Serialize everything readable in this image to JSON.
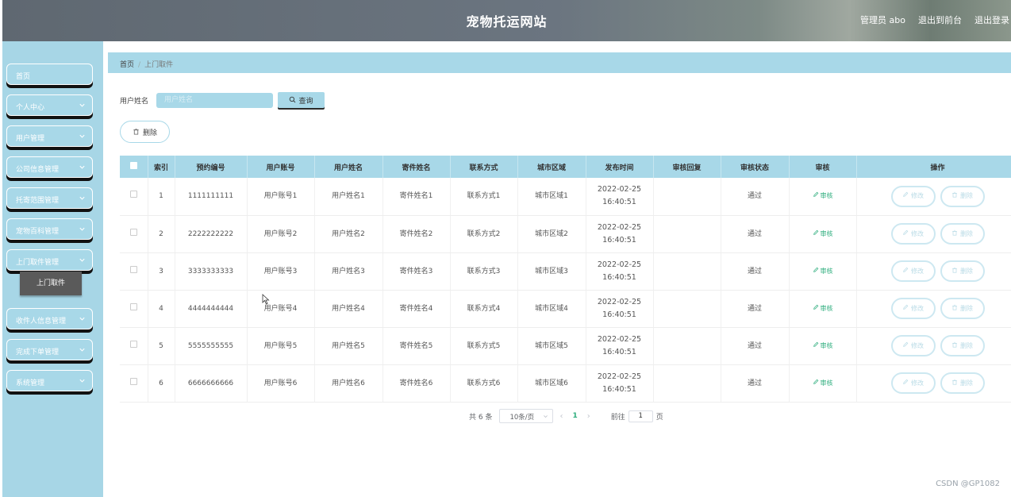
{
  "header": {
    "title": "宠物托运网站",
    "admin_label": "管理员 abo",
    "front_link": "退出到前台",
    "logout_link": "退出登录"
  },
  "sidebar": {
    "items": [
      {
        "label": "首页",
        "has_chevron": false
      },
      {
        "label": "个人中心",
        "has_chevron": true
      },
      {
        "label": "用户管理",
        "has_chevron": true
      },
      {
        "label": "公司信息管理",
        "has_chevron": true
      },
      {
        "label": "托寄范围管理",
        "has_chevron": true
      },
      {
        "label": "宠物百科管理",
        "has_chevron": true
      },
      {
        "label": "上门取件管理",
        "has_chevron": true
      },
      {
        "label": "收件人信息管理",
        "has_chevron": true
      },
      {
        "label": "完成下单管理",
        "has_chevron": true
      },
      {
        "label": "系统管理",
        "has_chevron": true
      }
    ],
    "active_sub": "上门取件"
  },
  "breadcrumb": {
    "home": "首页",
    "separator": "/",
    "current": "上门取件"
  },
  "search": {
    "label": "用户姓名",
    "placeholder": "用户姓名",
    "value": "",
    "button_label": "查询"
  },
  "toolbar": {
    "delete_label": "删除"
  },
  "table": {
    "columns": [
      "索引",
      "预约编号",
      "用户账号",
      "用户姓名",
      "寄件姓名",
      "联系方式",
      "城市区域",
      "发布时间",
      "审核回复",
      "审核状态",
      "审核",
      "操作"
    ],
    "rows": [
      {
        "index": "1",
        "booking_no": "1111111111",
        "account": "用户账号1",
        "user_name": "用户姓名1",
        "sender_name": "寄件姓名1",
        "contact": "联系方式1",
        "city": "城市区域1",
        "time": "2022-02-25 16:40:51",
        "reply": "",
        "status": "通过"
      },
      {
        "index": "2",
        "booking_no": "2222222222",
        "account": "用户账号2",
        "user_name": "用户姓名2",
        "sender_name": "寄件姓名2",
        "contact": "联系方式2",
        "city": "城市区域2",
        "time": "2022-02-25 16:40:51",
        "reply": "",
        "status": "通过"
      },
      {
        "index": "3",
        "booking_no": "3333333333",
        "account": "用户账号3",
        "user_name": "用户姓名3",
        "sender_name": "寄件姓名3",
        "contact": "联系方式3",
        "city": "城市区域3",
        "time": "2022-02-25 16:40:51",
        "reply": "",
        "status": "通过"
      },
      {
        "index": "4",
        "booking_no": "4444444444",
        "account": "用户账号4",
        "user_name": "用户姓名4",
        "sender_name": "寄件姓名4",
        "contact": "联系方式4",
        "city": "城市区域4",
        "time": "2022-02-25 16:40:51",
        "reply": "",
        "status": "通过"
      },
      {
        "index": "5",
        "booking_no": "5555555555",
        "account": "用户账号5",
        "user_name": "用户姓名5",
        "sender_name": "寄件姓名5",
        "contact": "联系方式5",
        "city": "城市区域5",
        "time": "2022-02-25 16:40:51",
        "reply": "",
        "status": "通过"
      },
      {
        "index": "6",
        "booking_no": "6666666666",
        "account": "用户账号6",
        "user_name": "用户姓名6",
        "sender_name": "寄件姓名6",
        "contact": "联系方式6",
        "city": "城市区域6",
        "time": "2022-02-25 16:40:51",
        "reply": "",
        "status": "通过"
      }
    ],
    "review_label": "审核",
    "edit_label": "修改",
    "delete_label": "删除"
  },
  "pagination": {
    "total_text": "共 6 条",
    "page_size": "10条/页",
    "current_page": "1",
    "goto_prefix": "前往",
    "goto_value": "1",
    "goto_suffix": "页"
  },
  "watermark": "CSDN @GP1082",
  "colors": {
    "accent": "#a8d8e8",
    "link_green": "#2fae7e",
    "sidebar_bg": "#a7d6e6",
    "active_sub_bg": "#5a5a5a"
  }
}
